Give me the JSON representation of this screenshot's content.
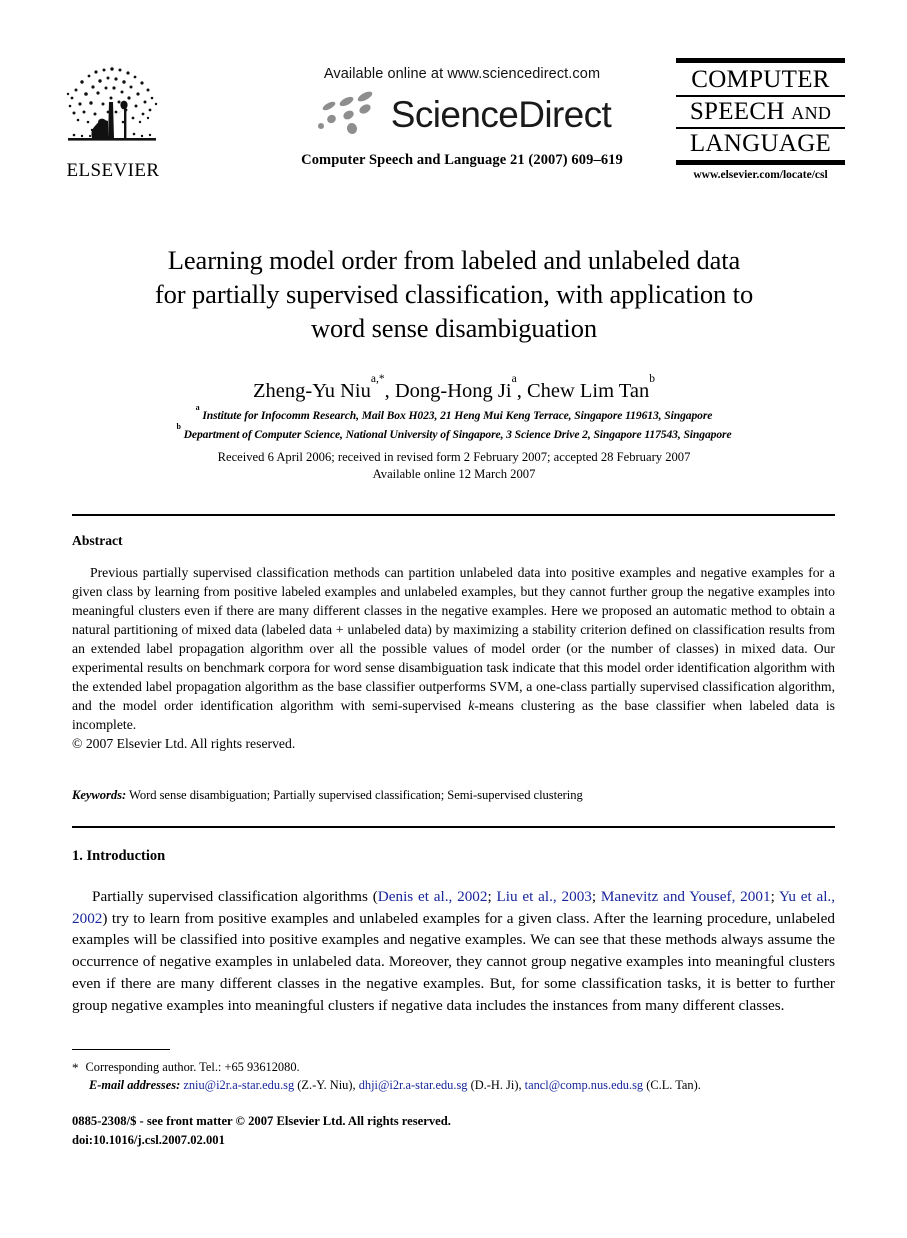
{
  "publisher": {
    "logo_name": "elsevier-tree-logo",
    "wordmark": "ELSEVIER"
  },
  "sciencedirect": {
    "available_line": "Available online at www.sciencedirect.com",
    "wordmark": "ScienceDirect",
    "journal_reference": "Computer Speech and Language 21 (2007) 609–619"
  },
  "journal_logo": {
    "line1": "COMPUTER",
    "line2_main": "SPEECH",
    "line2_small": "AND",
    "line3": "LANGUAGE",
    "url": "www.elsevier.com/locate/csl"
  },
  "article": {
    "title_line1": "Learning model order from labeled and unlabeled data",
    "title_line2": "for partially supervised classification, with application to",
    "title_line3": "word sense disambiguation",
    "authors": [
      {
        "name": "Zheng-Yu Niu",
        "marks": "a,*"
      },
      {
        "name": "Dong-Hong Ji",
        "marks": "a"
      },
      {
        "name": "Chew Lim Tan",
        "marks": "b"
      }
    ],
    "author_separator": ", ",
    "affiliations": [
      {
        "mark": "a",
        "text": "Institute for Infocomm Research, Mail Box H023, 21 Heng Mui Keng Terrace, Singapore 119613, Singapore"
      },
      {
        "mark": "b",
        "text": "Department of Computer Science, National University of Singapore, 3 Science Drive 2, Singapore 117543, Singapore"
      }
    ],
    "dates_line1": "Received 6 April 2006; received in revised form 2 February 2007; accepted 28 February 2007",
    "dates_line2": "Available online 12 March 2007"
  },
  "abstract": {
    "heading": "Abstract",
    "paragraph_part1": "Previous partially supervised classification methods can partition unlabeled data into positive examples and negative examples for a given class by learning from positive labeled examples and unlabeled examples, but they cannot further group the negative examples into meaningful clusters even if there are many different classes in the negative examples. Here we proposed an automatic method to obtain a natural partitioning of mixed data (labeled data + unlabeled data) by maximizing a stability criterion defined on classification results from an extended label propagation algorithm over all the possible values of model order (or the number of classes) in mixed data. Our experimental results on benchmark corpora for word sense disambiguation task indicate that this model order identification algorithm with the extended label propagation algorithm as the base classifier outperforms SVM, a one-class partially supervised classification algorithm, and the model order identification algorithm with semi-supervised ",
    "paragraph_italic": "k",
    "paragraph_part2": "-means clustering as the base classifier when labeled data is incomplete.",
    "copyright": "© 2007 Elsevier Ltd. All rights reserved."
  },
  "keywords": {
    "label": "Keywords:",
    "terms": "Word sense disambiguation; Partially supervised classification; Semi-supervised clustering"
  },
  "section": {
    "heading": "1. Introduction",
    "intro_lead": "Partially supervised classification algorithms (",
    "citations": [
      "Denis et al., 2002",
      "Liu et al., 2003",
      "Manevitz and Yousef, 2001",
      "Yu et al., 2002"
    ],
    "citation_separator": "; ",
    "intro_rest": ") try to learn from positive examples and unlabeled examples for a given class. After the learning procedure, unlabeled examples will be classified into positive examples and negative examples. We can see that these methods always assume the occurrence of negative examples in unlabeled data. Moreover, they cannot group negative examples into meaningful clusters even if there are many different classes in the negative examples. But, for some classification tasks, it is better to further group negative examples into meaningful clusters if negative data includes the instances from many different classes."
  },
  "footnotes": {
    "star": "*",
    "corresponding": "Corresponding author. Tel.: +65 93612080.",
    "emails_label": "E-mail addresses:",
    "emails": [
      {
        "address": "zniu@i2r.a-star.edu.sg",
        "owner": "(Z.-Y. Niu)"
      },
      {
        "address": "dhji@i2r.a-star.edu.sg",
        "owner": "(D.-H. Ji)"
      },
      {
        "address": "tancl@comp.nus.edu.sg",
        "owner": "(C.L. Tan)"
      }
    ],
    "email_separator": ", "
  },
  "footer": {
    "issn_line": "0885-2308/$ - see front matter © 2007 Elsevier Ltd. All rights reserved.",
    "doi_line": "doi:10.1016/j.csl.2007.02.001"
  },
  "colors": {
    "link": "#18269b",
    "text": "#000000",
    "sd_dot": "#8e8e8e"
  }
}
